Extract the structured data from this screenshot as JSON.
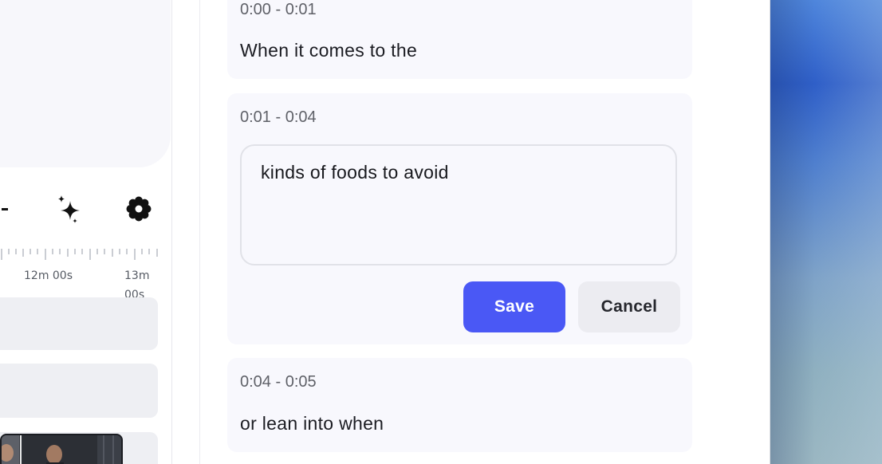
{
  "timeline": {
    "ruler_labels": [
      "12m 00s",
      "13m",
      "00s"
    ]
  },
  "transcript": {
    "segments": [
      {
        "time": "0:00 - 0:01",
        "text": "When it comes to the"
      },
      {
        "time": "0:01 - 0:04",
        "text": "kinds of foods to avoid"
      },
      {
        "time": "0:04 - 0:05",
        "text": "or lean into when"
      }
    ],
    "save_label": "Save",
    "cancel_label": "Cancel"
  },
  "icons": {
    "toolbar": [
      "minus-icon",
      "sparkle-icon",
      "gear-icon"
    ]
  },
  "colors": {
    "accent": "#4a58f5",
    "segment_bg": "#f8f8fd",
    "cancel_bg": "#ececf1"
  }
}
